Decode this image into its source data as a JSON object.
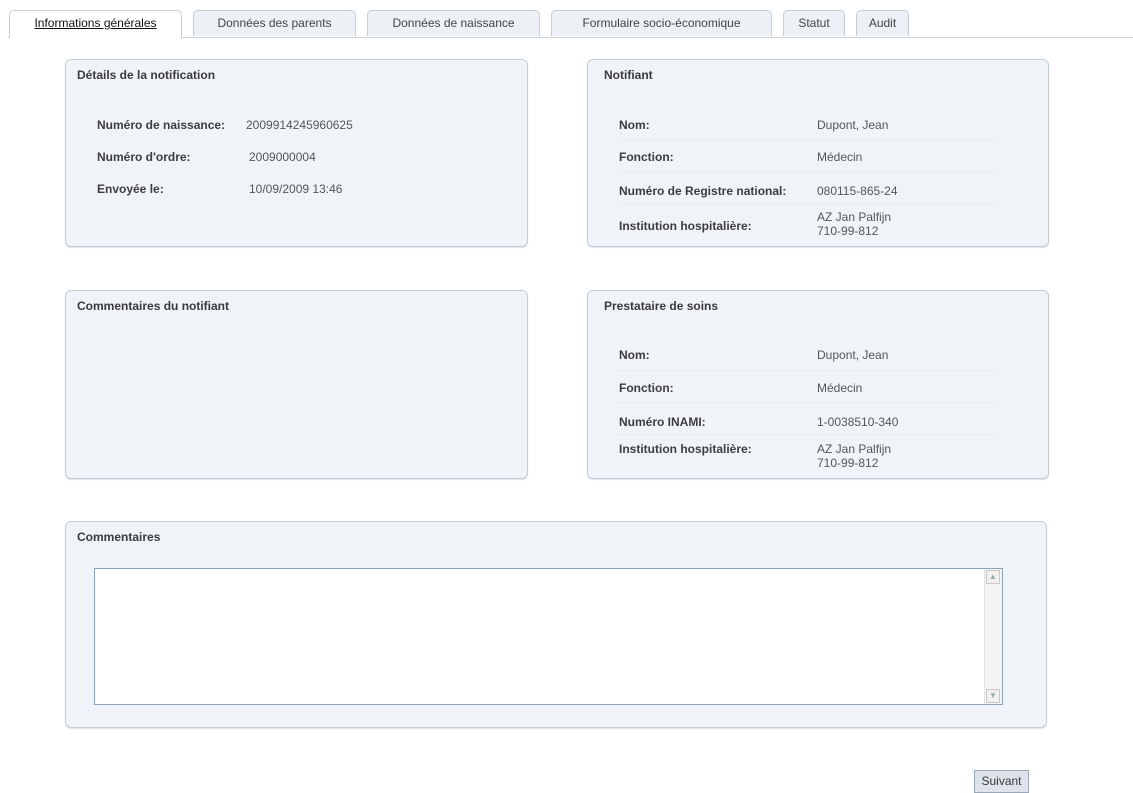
{
  "tabs": [
    {
      "label": "Informations générales",
      "active": true
    },
    {
      "label": "Données des parents",
      "active": false
    },
    {
      "label": "Données de naissance",
      "active": false
    },
    {
      "label": "Formulaire socio-économique",
      "active": false
    },
    {
      "label": "Statut",
      "active": false
    },
    {
      "label": "Audit",
      "active": false
    }
  ],
  "notification": {
    "title": "Détails de la notification",
    "rows": [
      {
        "label": "Numéro de naissance:",
        "value": "2009914245960625"
      },
      {
        "label": "Numéro d'ordre:",
        "value": "2009000004"
      },
      {
        "label": "Envoyée le:",
        "value": "10/09/2009 13:46"
      }
    ]
  },
  "notifiant": {
    "title": "Notifiant",
    "rows": [
      {
        "label": "Nom:",
        "value": "Dupont, Jean"
      },
      {
        "label": "Fonction:",
        "value": "Médecin"
      },
      {
        "label": "Numéro de Registre national:",
        "value": "080115-865-24"
      },
      {
        "label": "Institution hospitalière:",
        "value": "AZ Jan Palfijn\n710-99-812"
      }
    ]
  },
  "comments_notifiant": {
    "title": "Commentaires du notifiant"
  },
  "prestataire": {
    "title": "Prestataire de soins",
    "rows": [
      {
        "label": "Nom:",
        "value": "Dupont, Jean"
      },
      {
        "label": "Fonction:",
        "value": "Médecin"
      },
      {
        "label": "Numéro INAMI:",
        "value": "1-0038510-340"
      },
      {
        "label": "Institution hospitalière:",
        "value": "AZ Jan Palfijn\n710-99-812"
      }
    ]
  },
  "commentaires": {
    "title": "Commentaires",
    "value": ""
  },
  "buttons": {
    "next": "Suivant"
  }
}
